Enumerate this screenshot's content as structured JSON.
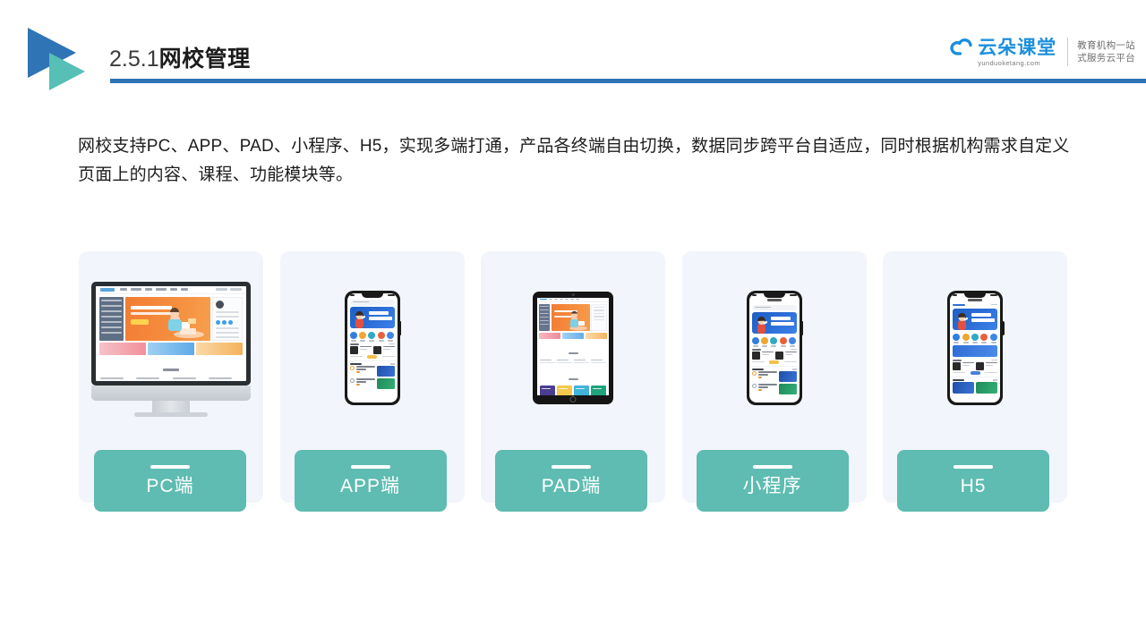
{
  "header": {
    "title_number": "2.5.1",
    "title_text": "网校管理",
    "accent_color": "#2f74b5",
    "logo_icon": "double-triangle-play-icon"
  },
  "brand": {
    "cloud_icon": "cloud-icon",
    "name": "云朵课堂",
    "domain": "yunduoketang.com",
    "tagline_line1": "教育机构一站",
    "tagline_line2": "式服务云平台",
    "color": "#1b8fdc"
  },
  "content": {
    "paragraph": "网校支持PC、APP、PAD、小程序、H5，实现多端打通，产品各终端自由切换，数据同步跨平台自适应，同时根据机构需求自定义页面上的内容、课程、功能模块等。"
  },
  "cards": [
    {
      "label": "PC端",
      "device": "desktop-monitor",
      "device_icon": "desktop-monitor-icon"
    },
    {
      "label": "APP端",
      "device": "smartphone",
      "device_icon": "smartphone-icon"
    },
    {
      "label": "PAD端",
      "device": "tablet",
      "device_icon": "tablet-icon"
    },
    {
      "label": "小程序",
      "device": "smartphone",
      "device_icon": "smartphone-icon"
    },
    {
      "label": "H5",
      "device": "smartphone",
      "device_icon": "smartphone-icon"
    }
  ],
  "theme": {
    "label_band_color": "#5ebcb2",
    "card_background": "#f2f5fb",
    "page_background": "#ffffff",
    "banner_blue": "#2d6fd8",
    "banner_orange": "#f5903f"
  }
}
